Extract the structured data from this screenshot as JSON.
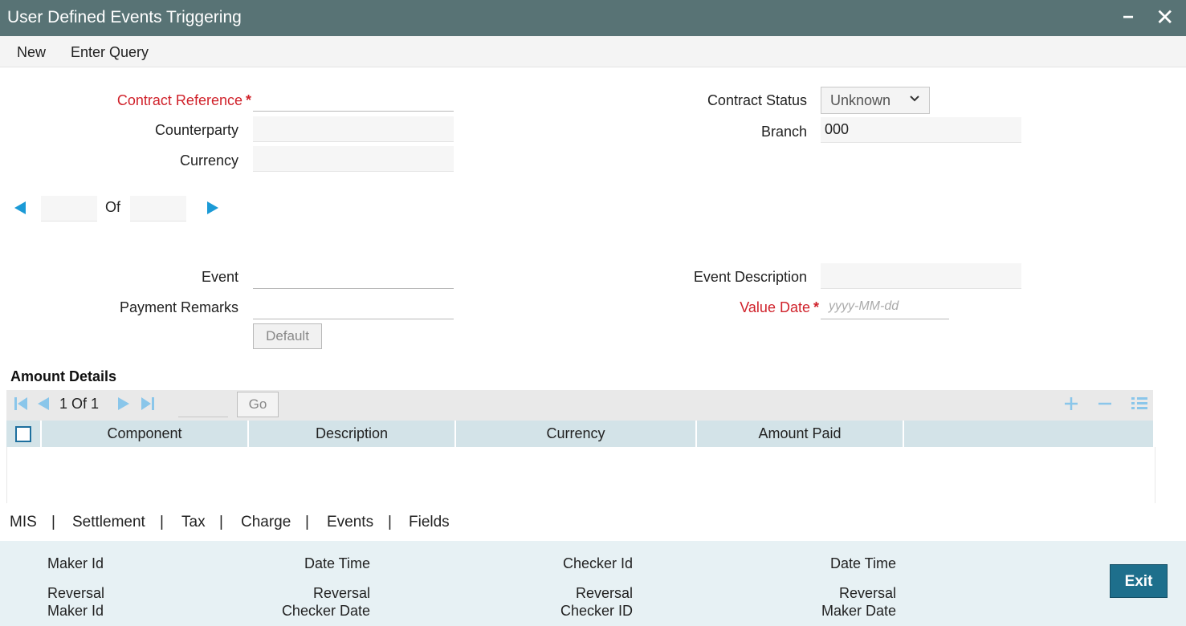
{
  "window": {
    "title": "User Defined Events Triggering",
    "minimize_glyph": "−",
    "close_glyph": "✕"
  },
  "menu": {
    "new": "New",
    "enter_query": "Enter Query"
  },
  "form": {
    "contract_reference": {
      "label": "Contract Reference",
      "required_mark": "*",
      "value": ""
    },
    "counterparty": {
      "label": "Counterparty",
      "value": ""
    },
    "currency": {
      "label": "Currency",
      "value": ""
    },
    "contract_status": {
      "label": "Contract Status",
      "selected": "Unknown"
    },
    "branch": {
      "label": "Branch",
      "value": "000"
    },
    "event": {
      "label": "Event",
      "value": ""
    },
    "payment_remarks": {
      "label": "Payment Remarks",
      "value": ""
    },
    "event_description": {
      "label": "Event Description",
      "value": ""
    },
    "value_date": {
      "label": "Value Date",
      "required_mark": "*",
      "placeholder": "yyyy-MM-dd"
    },
    "default_button": "Default"
  },
  "record_nav": {
    "of_label": "Of",
    "current": "",
    "total": ""
  },
  "amount_details": {
    "title": "Amount Details",
    "page_text": "1 Of 1",
    "go_label": "Go",
    "columns": [
      "Component",
      "Description",
      "Currency",
      "Amount Paid"
    ]
  },
  "tabs": [
    "MIS",
    "Settlement",
    "Tax",
    "Charge",
    "Events",
    "Fields"
  ],
  "tab_separator": "|",
  "footer": {
    "maker_id": "Maker Id",
    "date_time_1": "Date Time",
    "checker_id": "Checker Id",
    "date_time_2": "Date Time",
    "rev_maker_id_1": "Reversal",
    "rev_maker_id_2": "Maker Id",
    "rev_checker_date_1": "Reversal",
    "rev_checker_date_2": "Checker Date",
    "rev_checker_id_1": "Reversal",
    "rev_checker_id_2": "Checker ID",
    "rev_maker_date_1": "Reversal",
    "rev_maker_date_2": "Maker Date",
    "exit_label": "Exit"
  },
  "colors": {
    "titlebar": "#587375",
    "required": "#d0222b",
    "accent": "#1b9ad6",
    "grid_header": "#d3e3e8",
    "footer": "#e7f1f4",
    "exit_button": "#1e6f8c"
  }
}
